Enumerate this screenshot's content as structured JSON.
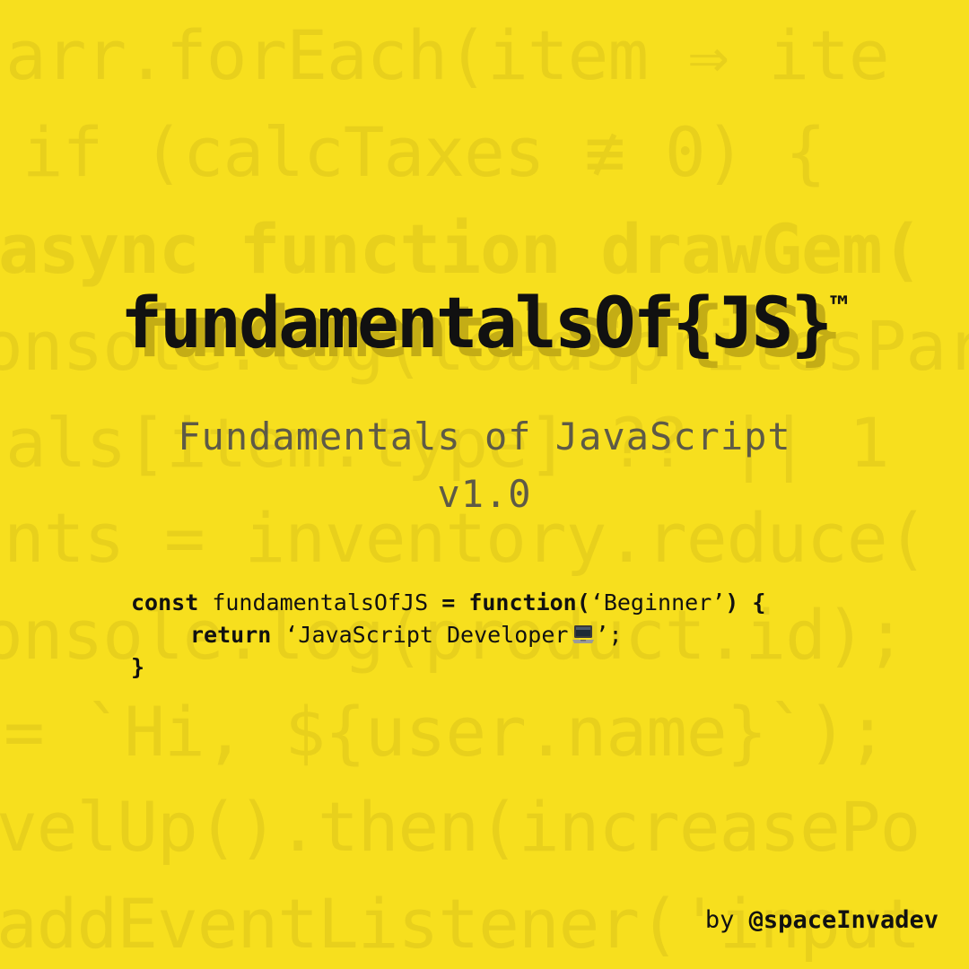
{
  "background_code": [
    "arr.forEach(item ⇒ ite",
    " if (calcTaxes ≢ 0) {",
    "async function drawGem(",
    "onsole.log(loadSpritesPars",
    "als[item.type] ?? || 1",
    "nts = inventory.reduce(",
    "onsole.log(product.id);",
    "= `Hi, ${user.name}`);",
    "velUp().then(increasePo",
    "addEventListener('input"
  ],
  "title": {
    "main": "fundamentalsOf{JS}",
    "mark": "™"
  },
  "subtitle": {
    "line1": "Fundamentals of JavaScript",
    "line2": "v1.0"
  },
  "snippet": {
    "line1": {
      "kw_const": "const",
      "name": " fundamentalsOfJS ",
      "kw_eq": "=",
      "kw_function": " function(",
      "arg": "‘Beginner’",
      "kw_close": ") {"
    },
    "line2": {
      "kw_return": "return",
      "value": " ‘JavaScript Developer",
      "icon": "laptop-icon",
      "end": "’;"
    },
    "line3": {
      "brace": "}"
    }
  },
  "credit": {
    "prefix": "by ",
    "handle": "@spaceInvadev"
  },
  "colors": {
    "background": "#f7df1e",
    "background_text": "#e8d01c",
    "title": "#111111",
    "title_shadow": "#c4ad15",
    "subtitle": "#5e5a46"
  }
}
